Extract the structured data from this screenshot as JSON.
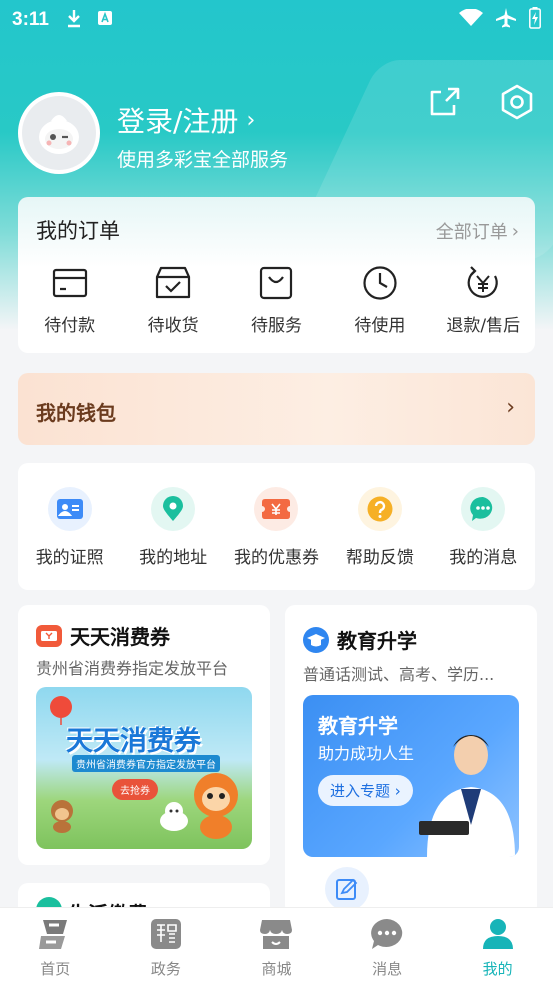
{
  "status_bar": {
    "time": "3:11"
  },
  "header": {
    "login_label": "登录/注册",
    "subtitle": "使用多彩宝全部服务"
  },
  "orders": {
    "title": "我的订单",
    "all_label": "全部订单",
    "items": [
      {
        "label": "待付款",
        "icon": "wallet-card-icon"
      },
      {
        "label": "待收货",
        "icon": "inbox-check-icon"
      },
      {
        "label": "待服务",
        "icon": "shopping-bag-icon"
      },
      {
        "label": "待使用",
        "icon": "clock-icon"
      },
      {
        "label": "退款/售后",
        "icon": "yuan-refund-icon"
      }
    ]
  },
  "wallet": {
    "label": "我的钱包"
  },
  "tools": {
    "items": [
      {
        "label": "我的证照",
        "icon": "id-card-icon",
        "color": "#3d8bf7"
      },
      {
        "label": "我的地址",
        "icon": "location-pin-icon",
        "color": "#1bbf9e"
      },
      {
        "label": "我的优惠券",
        "icon": "coupon-icon",
        "color": "#f36a42"
      },
      {
        "label": "帮助反馈",
        "icon": "help-icon",
        "color": "#f6b026"
      },
      {
        "label": "我的消息",
        "icon": "chat-icon",
        "color": "#1bbf9e"
      }
    ]
  },
  "promos": {
    "left": {
      "title": "天天消费券",
      "subtitle": "贵州省消费券指定发放平台",
      "banner_title": "天天消费券",
      "banner_tagline": "贵州省消费券官方指定发放平台",
      "banner_button": "去抢券"
    },
    "right": {
      "title": "教育升学",
      "subtitle": "普通话测试、高考、学历...",
      "banner_title": "教育升学",
      "banner_subtitle": "助力成功人生",
      "banner_button": "进入专题"
    }
  },
  "partial_card": {
    "title": "生活缴费"
  },
  "tabbar": {
    "items": [
      {
        "label": "首页",
        "icon": "home-icon"
      },
      {
        "label": "政务",
        "icon": "government-icon"
      },
      {
        "label": "商城",
        "icon": "store-icon"
      },
      {
        "label": "消息",
        "icon": "message-icon"
      },
      {
        "label": "我的",
        "icon": "profile-icon",
        "active": true
      }
    ]
  },
  "colors": {
    "brand": "#23c6cc",
    "active_tab": "#17b4b8",
    "wallet_text": "#6b3b1e"
  }
}
